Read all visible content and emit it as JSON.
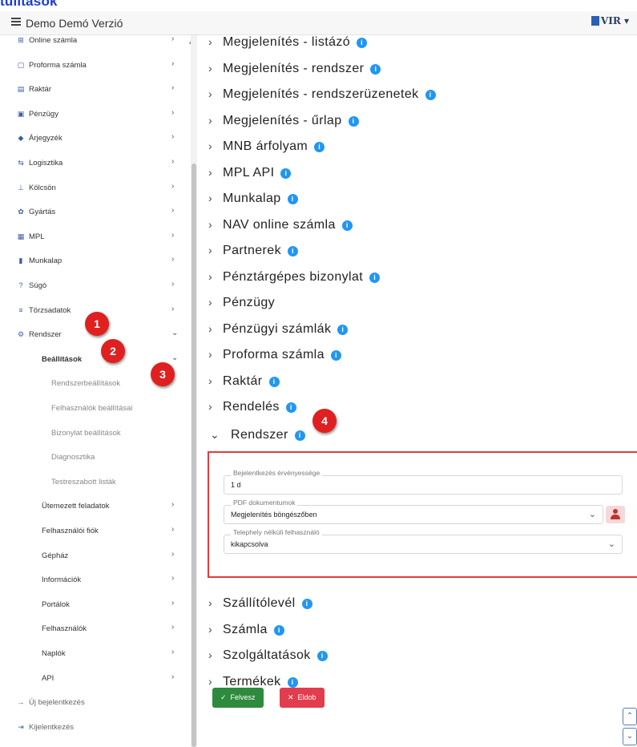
{
  "doc_title": "tulítások",
  "header": {
    "app_title": "Demo Demó Verzió",
    "logo_text": "VIR"
  },
  "sidebar": {
    "items": [
      {
        "label": "Online számla",
        "icon": "online-invoice-icon",
        "glyph": "⊞"
      },
      {
        "label": "Proforma számla",
        "icon": "proforma-icon",
        "glyph": "▢"
      },
      {
        "label": "Raktár",
        "icon": "warehouse-icon",
        "glyph": "▤"
      },
      {
        "label": "Pénzügy",
        "icon": "money-icon",
        "glyph": "▣"
      },
      {
        "label": "Árjegyzék",
        "icon": "tag-icon",
        "glyph": "◆"
      },
      {
        "label": "Logisztika",
        "icon": "logistics-icon",
        "glyph": "⇆"
      },
      {
        "label": "Kölcsön",
        "icon": "loan-icon",
        "glyph": "⊥"
      },
      {
        "label": "Gyártás",
        "icon": "production-icon",
        "glyph": "✿"
      },
      {
        "label": "MPL",
        "icon": "mpl-icon",
        "glyph": "▦"
      },
      {
        "label": "Munkalap",
        "icon": "worksheet-icon",
        "glyph": "▮"
      },
      {
        "label": "Súgó",
        "icon": "help-icon",
        "glyph": "?"
      },
      {
        "label": "Törzsadatok",
        "icon": "database-icon",
        "glyph": "≡"
      },
      {
        "label": "Rendszer",
        "icon": "system-icon",
        "glyph": "⚙"
      }
    ],
    "settings_label": "Beállítások",
    "settings_sub": [
      "Rendszerbeállítások",
      "Felhasználók beállításai",
      "Bizonylat beállítások",
      "Diagnosztika",
      "Testreszabott listák"
    ],
    "level2": [
      "Ütemezett feladatok",
      "Felhasználói fiók",
      "Gépház",
      "Információk",
      "Portálok",
      "Felhasználók",
      "Naplók",
      "API"
    ],
    "bottom": [
      {
        "label": "Új bejelentkezés",
        "icon": "login-icon",
        "glyph": "→"
      },
      {
        "label": "Kijelentkezés",
        "icon": "logout-icon",
        "glyph": "⇥"
      }
    ]
  },
  "accordion": [
    {
      "label": "Megjelenítés - listázó",
      "info": true
    },
    {
      "label": "Megjelenítés - rendszer",
      "info": true
    },
    {
      "label": "Megjelenítés - rendszerüzenetek",
      "info": true
    },
    {
      "label": "Megjelenítés - űrlap",
      "info": true
    },
    {
      "label": "MNB árfolyam",
      "info": true
    },
    {
      "label": "MPL API",
      "info": true
    },
    {
      "label": "Munkalap",
      "info": true
    },
    {
      "label": "NAV online számla",
      "info": true
    },
    {
      "label": "Partnerek",
      "info": true
    },
    {
      "label": "Pénztárgépes bizonylat",
      "info": true
    },
    {
      "label": "Pénzügy",
      "info": false
    },
    {
      "label": "Pénzügyi számlák",
      "info": true
    },
    {
      "label": "Proforma számla",
      "info": true
    },
    {
      "label": "Raktár",
      "info": true
    },
    {
      "label": "Rendelés",
      "info": true
    },
    {
      "label": "Rendszer",
      "info": true,
      "expanded": true
    },
    {
      "label": "Szállítólevél",
      "info": true
    },
    {
      "label": "Számla",
      "info": true
    },
    {
      "label": "Szolgáltatások",
      "info": true
    },
    {
      "label": "Termékek",
      "info": true
    }
  ],
  "rendszer_panel": {
    "login_validity": {
      "label": "Bejelentkezés érvényessége",
      "value": "1 d"
    },
    "pdf_documents": {
      "label": "PDF dokumentumok",
      "value": "Megjelenítés böngészőben"
    },
    "no_site_user": {
      "label": "Telephely nélküli felhasználó",
      "value": "kikapcsolva"
    }
  },
  "buttons": {
    "save": "Felvesz",
    "discard": "Eldob"
  },
  "markers": [
    "1",
    "2",
    "3",
    "4"
  ],
  "colors": {
    "info": "#2196f3",
    "save": "#2e8b3e",
    "discard": "#e23d4f",
    "highlight": "#e03c3c",
    "marker": "#e02020"
  }
}
